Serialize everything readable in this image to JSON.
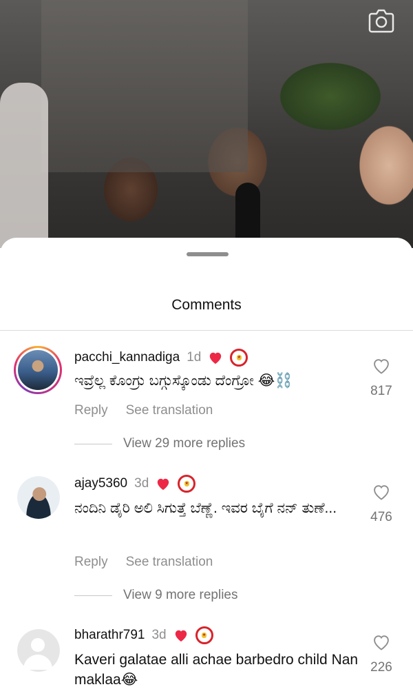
{
  "sheet": {
    "title": "Comments"
  },
  "icons": {
    "camera": "camera-icon",
    "like": "heart-outline-icon",
    "reaction": "red-heart-icon",
    "badge": "profile-badge-icon"
  },
  "colors": {
    "accent_red": "#ed2846",
    "secondary_text": "#8e8e8e",
    "divider": "#dbdbdb"
  },
  "comments": [
    {
      "username": "pacchi_kannadiga",
      "time": "1d",
      "text": "ಇವ್ರೆಲ್ಲ ಕೊಂಗ್ರು ಬಗ್ಗುಸ್ಕೊಂಡು ದೆಂಗ್ರೋ 😂⛓️",
      "reply": "Reply",
      "translate": "See translation",
      "replies": "View 29 more replies",
      "likes": "817"
    },
    {
      "username": "ajay5360",
      "time": "3d",
      "text": "ನಂದಿನಿ ಡೈರಿ ಅಲಿ ಸಿಗುತ್ತೆ ಬೆಣ್ಣೆ. ಇವರ ಬೈಗೆ ನನ್ ತುಣೆ...",
      "reply": "Reply",
      "translate": "See translation",
      "replies": "View 9 more replies",
      "likes": "476"
    },
    {
      "username": "bharathr791",
      "time": "3d",
      "text": "Kaveri galatae alli achae barbedro child Nan maklaa😂",
      "likes": "226"
    }
  ]
}
